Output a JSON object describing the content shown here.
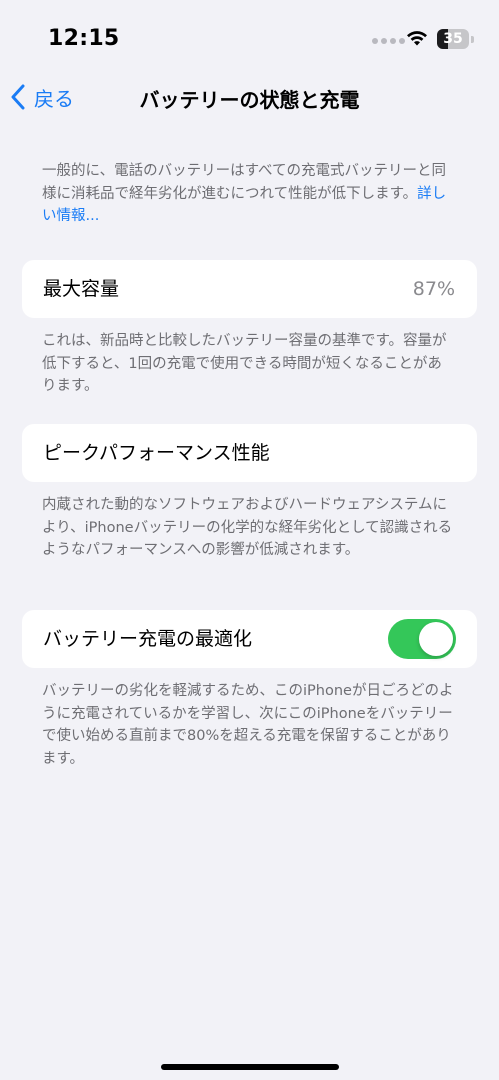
{
  "status_bar": {
    "time": "12:15",
    "battery_level": "35",
    "icons": [
      "signal-dots-icon",
      "wifi-icon",
      "battery-icon"
    ]
  },
  "nav": {
    "back_label": "戻る",
    "title": "バッテリーの状態と充電",
    "back_icon": "chevron-left-icon"
  },
  "intro": {
    "text": "一般的に、電話のバッテリーはすべての充電式バッテリーと同様に消耗品で経年劣化が進むにつれて性能が低下します。",
    "link": "詳しい情報..."
  },
  "max_capacity": {
    "label": "最大容量",
    "value": "87%",
    "footnote": "これは、新品時と比較したバッテリー容量の基準です。容量が低下すると、1回の充電で使用できる時間が短くなることがあります。"
  },
  "peak_performance": {
    "label": "ピークパフォーマンス性能",
    "footnote": "内蔵された動的なソフトウェアおよびハードウェアシステムにより、iPhoneバッテリーの化学的な経年劣化として認識されるようなパフォーマンスへの影響が低減されます。"
  },
  "optimized_charging": {
    "label": "バッテリー充電の最適化",
    "enabled": true,
    "footnote": "バッテリーの劣化を軽減するため、このiPhoneが日ごろどのように充電されているかを学習し、次にこのiPhoneをバッテリーで使い始める直前まで80%を超える充電を保留することがあります。"
  },
  "colors": {
    "background": "#f2f2f7",
    "accent": "#1a7cf5",
    "toggle_on": "#34c759",
    "secondary_text": "#6e6e73"
  }
}
